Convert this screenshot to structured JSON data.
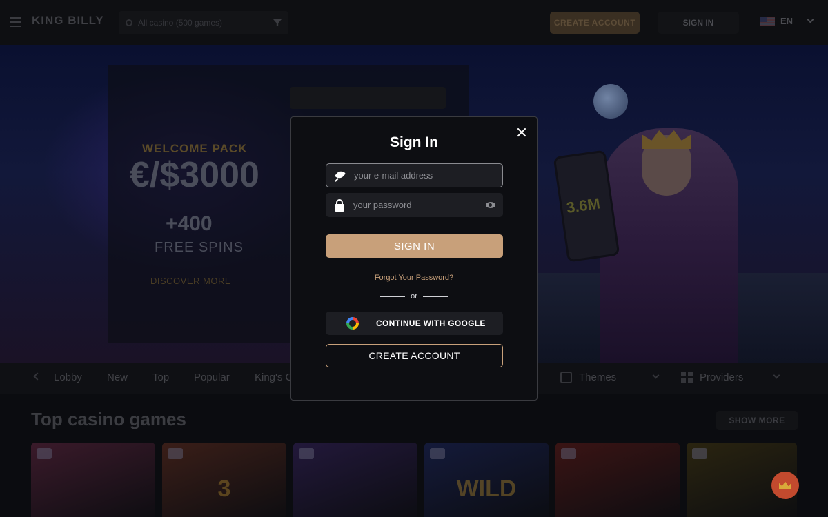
{
  "header": {
    "logo_text": "KING BILLY",
    "search_placeholder": "All casino (500 games)",
    "signup_label": "CREATE ACCOUNT",
    "signin_label": "SIGN IN",
    "language": "EN"
  },
  "hero": {
    "welcome": "WELCOME PACK",
    "amount": "€/$3000",
    "spins": "+400",
    "free_spins": "FREE SPINS",
    "discover": "DISCOVER MORE",
    "phone_text": "3.6M"
  },
  "categories": {
    "items": [
      "Lobby",
      "New",
      "Top",
      "Popular",
      "King's C"
    ],
    "themes_label": "Themes",
    "providers_label": "Providers"
  },
  "games": {
    "title": "Top casino games",
    "show_more": "SHOW MORE",
    "tiles": [
      {
        "name": "",
        "color": "#3a1a2a"
      },
      {
        "name": "3",
        "color": "#3a1e18"
      },
      {
        "name": "",
        "color": "#22183a"
      },
      {
        "name": "WILD",
        "color": "#141a3a"
      },
      {
        "name": "",
        "color": "#3a1414"
      },
      {
        "name": "",
        "color": "#2a2410"
      }
    ]
  },
  "modal": {
    "title": "Sign In",
    "email_placeholder": "your e-mail address",
    "password_placeholder": "your password",
    "signin_button": "SIGN IN",
    "forgot": "Forgot Your Password?",
    "or": "or",
    "google_button": "CONTINUE WITH GOOGLE",
    "create_account": "CREATE ACCOUNT"
  },
  "colors": {
    "accent": "#c8a07a",
    "modal_bg": "#0d0e12",
    "field_bg": "#1d1e23"
  }
}
